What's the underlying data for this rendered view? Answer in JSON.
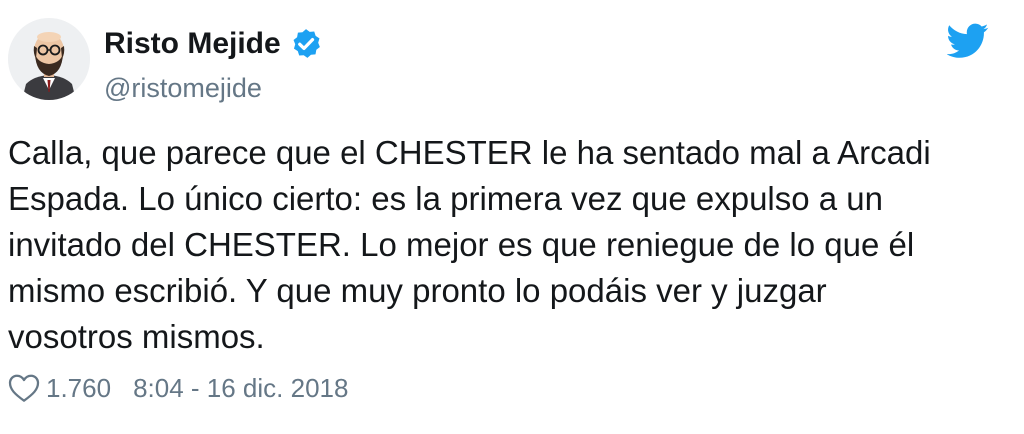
{
  "author": {
    "name": "Risto Mejide",
    "handle": "@ristomejide",
    "verified": true,
    "avatar_icon": "bearded-man-avatar"
  },
  "tweet": {
    "lines": [
      "Calla, que parece que el CHESTER le ha sentado mal a Arcadi",
      "Espada. Lo único cierto: es la primera vez que expulso a un",
      "invitado del CHESTER. Lo mejor es que reniegue de lo que él",
      "mismo escribió. Y que muy pronto lo podáis ver y juzgar",
      "vosotros mismos."
    ]
  },
  "footer": {
    "likes": "1.760",
    "timestamp": "8:04 - 16 dic. 2018"
  },
  "icons": {
    "brand": "twitter-bird-icon",
    "verified": "verified-badge-icon",
    "like": "heart-outline-icon"
  },
  "colors": {
    "accent": "#1da1f2",
    "text": "#14171a",
    "secondary": "#657786"
  }
}
